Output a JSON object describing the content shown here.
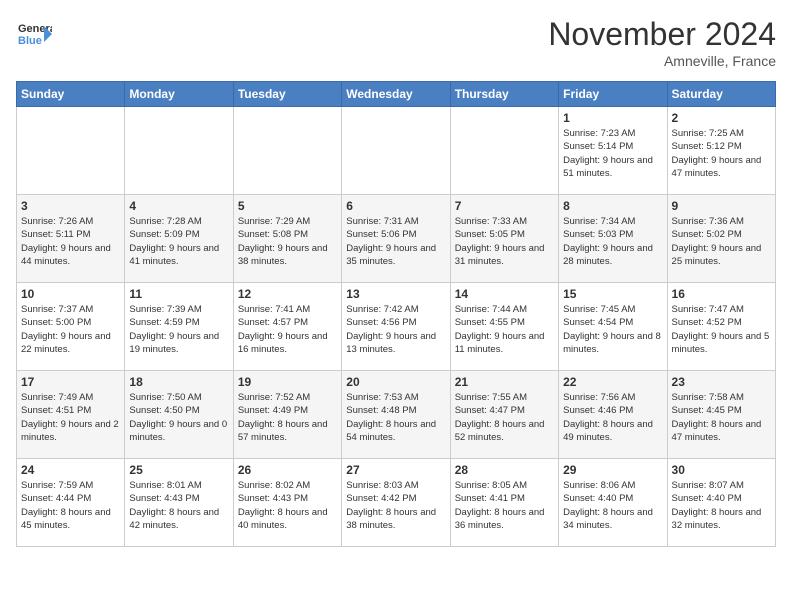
{
  "header": {
    "logo_line1": "General",
    "logo_line2": "Blue",
    "month": "November 2024",
    "location": "Amneville, France"
  },
  "weekdays": [
    "Sunday",
    "Monday",
    "Tuesday",
    "Wednesday",
    "Thursday",
    "Friday",
    "Saturday"
  ],
  "weeks": [
    [
      {
        "day": "",
        "info": "",
        "empty": true
      },
      {
        "day": "",
        "info": "",
        "empty": true
      },
      {
        "day": "",
        "info": "",
        "empty": true
      },
      {
        "day": "",
        "info": "",
        "empty": true
      },
      {
        "day": "",
        "info": "",
        "empty": true
      },
      {
        "day": "1",
        "info": "Sunrise: 7:23 AM\nSunset: 5:14 PM\nDaylight: 9 hours and 51 minutes.",
        "empty": false
      },
      {
        "day": "2",
        "info": "Sunrise: 7:25 AM\nSunset: 5:12 PM\nDaylight: 9 hours and 47 minutes.",
        "empty": false
      }
    ],
    [
      {
        "day": "3",
        "info": "Sunrise: 7:26 AM\nSunset: 5:11 PM\nDaylight: 9 hours and 44 minutes.",
        "empty": false
      },
      {
        "day": "4",
        "info": "Sunrise: 7:28 AM\nSunset: 5:09 PM\nDaylight: 9 hours and 41 minutes.",
        "empty": false
      },
      {
        "day": "5",
        "info": "Sunrise: 7:29 AM\nSunset: 5:08 PM\nDaylight: 9 hours and 38 minutes.",
        "empty": false
      },
      {
        "day": "6",
        "info": "Sunrise: 7:31 AM\nSunset: 5:06 PM\nDaylight: 9 hours and 35 minutes.",
        "empty": false
      },
      {
        "day": "7",
        "info": "Sunrise: 7:33 AM\nSunset: 5:05 PM\nDaylight: 9 hours and 31 minutes.",
        "empty": false
      },
      {
        "day": "8",
        "info": "Sunrise: 7:34 AM\nSunset: 5:03 PM\nDaylight: 9 hours and 28 minutes.",
        "empty": false
      },
      {
        "day": "9",
        "info": "Sunrise: 7:36 AM\nSunset: 5:02 PM\nDaylight: 9 hours and 25 minutes.",
        "empty": false
      }
    ],
    [
      {
        "day": "10",
        "info": "Sunrise: 7:37 AM\nSunset: 5:00 PM\nDaylight: 9 hours and 22 minutes.",
        "empty": false
      },
      {
        "day": "11",
        "info": "Sunrise: 7:39 AM\nSunset: 4:59 PM\nDaylight: 9 hours and 19 minutes.",
        "empty": false
      },
      {
        "day": "12",
        "info": "Sunrise: 7:41 AM\nSunset: 4:57 PM\nDaylight: 9 hours and 16 minutes.",
        "empty": false
      },
      {
        "day": "13",
        "info": "Sunrise: 7:42 AM\nSunset: 4:56 PM\nDaylight: 9 hours and 13 minutes.",
        "empty": false
      },
      {
        "day": "14",
        "info": "Sunrise: 7:44 AM\nSunset: 4:55 PM\nDaylight: 9 hours and 11 minutes.",
        "empty": false
      },
      {
        "day": "15",
        "info": "Sunrise: 7:45 AM\nSunset: 4:54 PM\nDaylight: 9 hours and 8 minutes.",
        "empty": false
      },
      {
        "day": "16",
        "info": "Sunrise: 7:47 AM\nSunset: 4:52 PM\nDaylight: 9 hours and 5 minutes.",
        "empty": false
      }
    ],
    [
      {
        "day": "17",
        "info": "Sunrise: 7:49 AM\nSunset: 4:51 PM\nDaylight: 9 hours and 2 minutes.",
        "empty": false
      },
      {
        "day": "18",
        "info": "Sunrise: 7:50 AM\nSunset: 4:50 PM\nDaylight: 9 hours and 0 minutes.",
        "empty": false
      },
      {
        "day": "19",
        "info": "Sunrise: 7:52 AM\nSunset: 4:49 PM\nDaylight: 8 hours and 57 minutes.",
        "empty": false
      },
      {
        "day": "20",
        "info": "Sunrise: 7:53 AM\nSunset: 4:48 PM\nDaylight: 8 hours and 54 minutes.",
        "empty": false
      },
      {
        "day": "21",
        "info": "Sunrise: 7:55 AM\nSunset: 4:47 PM\nDaylight: 8 hours and 52 minutes.",
        "empty": false
      },
      {
        "day": "22",
        "info": "Sunrise: 7:56 AM\nSunset: 4:46 PM\nDaylight: 8 hours and 49 minutes.",
        "empty": false
      },
      {
        "day": "23",
        "info": "Sunrise: 7:58 AM\nSunset: 4:45 PM\nDaylight: 8 hours and 47 minutes.",
        "empty": false
      }
    ],
    [
      {
        "day": "24",
        "info": "Sunrise: 7:59 AM\nSunset: 4:44 PM\nDaylight: 8 hours and 45 minutes.",
        "empty": false
      },
      {
        "day": "25",
        "info": "Sunrise: 8:01 AM\nSunset: 4:43 PM\nDaylight: 8 hours and 42 minutes.",
        "empty": false
      },
      {
        "day": "26",
        "info": "Sunrise: 8:02 AM\nSunset: 4:43 PM\nDaylight: 8 hours and 40 minutes.",
        "empty": false
      },
      {
        "day": "27",
        "info": "Sunrise: 8:03 AM\nSunset: 4:42 PM\nDaylight: 8 hours and 38 minutes.",
        "empty": false
      },
      {
        "day": "28",
        "info": "Sunrise: 8:05 AM\nSunset: 4:41 PM\nDaylight: 8 hours and 36 minutes.",
        "empty": false
      },
      {
        "day": "29",
        "info": "Sunrise: 8:06 AM\nSunset: 4:40 PM\nDaylight: 8 hours and 34 minutes.",
        "empty": false
      },
      {
        "day": "30",
        "info": "Sunrise: 8:07 AM\nSunset: 4:40 PM\nDaylight: 8 hours and 32 minutes.",
        "empty": false
      }
    ]
  ]
}
